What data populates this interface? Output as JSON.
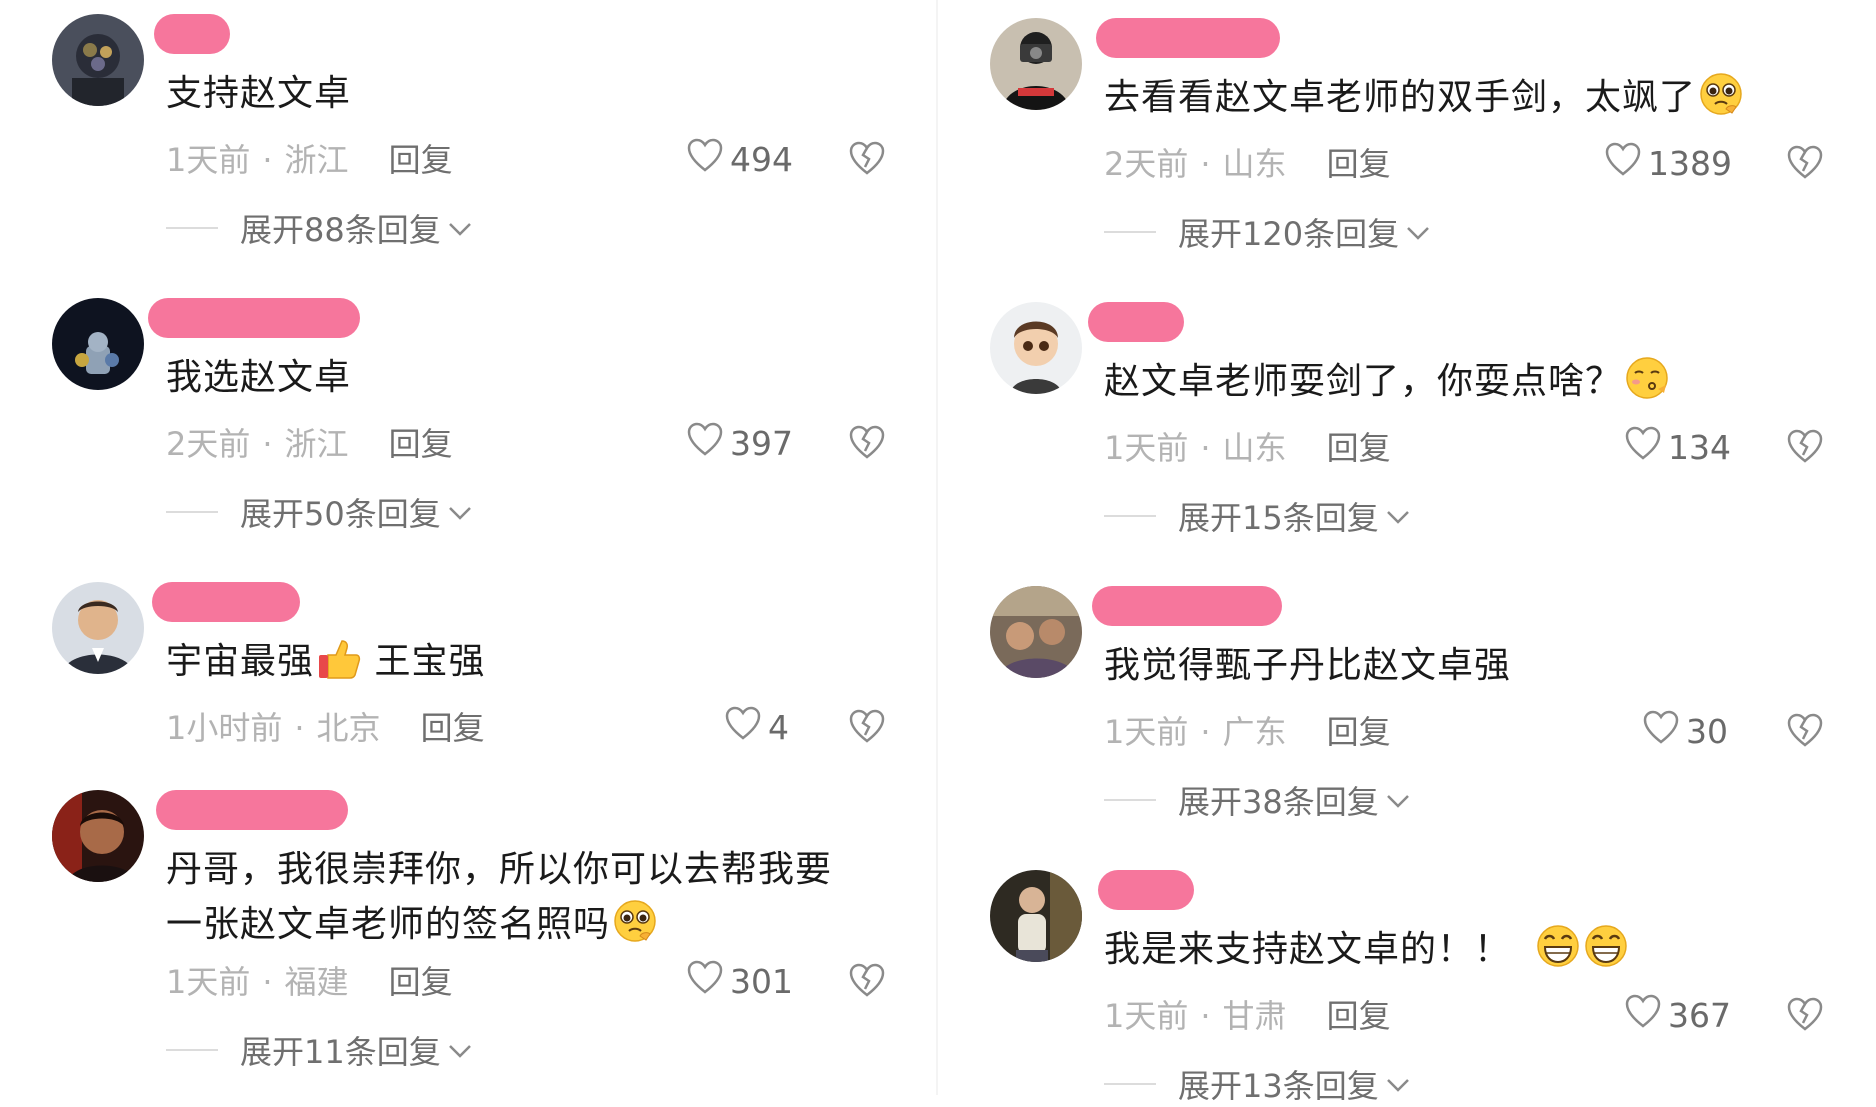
{
  "left": [
    {
      "text": "支持赵文卓",
      "time": "1天前",
      "location": "浙江",
      "reply": "回复",
      "likes": "494",
      "expand": "展开88条回复",
      "emoji": []
    },
    {
      "text": "我选赵文卓",
      "time": "2天前",
      "location": "浙江",
      "reply": "回复",
      "likes": "397",
      "expand": "展开50条回复",
      "emoji": []
    },
    {
      "text_a": "宇宙最强",
      "text_b": " 王宝强",
      "time": "1小时前",
      "location": "北京",
      "reply": "回复",
      "likes": "4",
      "expand": "",
      "emoji": [
        "thumbs-up-emoji"
      ]
    },
    {
      "text_line1": "丹哥，我很崇拜你，所以你可以去帮我要",
      "text_line2": "一张赵文卓老师的签名照吗",
      "time": "1天前",
      "location": "福建",
      "reply": "回复",
      "likes": "301",
      "expand": "展开11条回复",
      "emoji": [
        "pleading-emoji"
      ]
    }
  ],
  "right": [
    {
      "text": "去看看赵文卓老师的双手剑，太飒了",
      "time": "2天前",
      "location": "山东",
      "reply": "回复",
      "likes": "1389",
      "expand": "展开120条回复",
      "emoji": [
        "pleading-emoji"
      ]
    },
    {
      "text": "赵文卓老师耍剑了，你耍点啥？",
      "time": "1天前",
      "location": "山东",
      "reply": "回复",
      "likes": "134",
      "expand": "展开15条回复",
      "emoji": [
        "kissing-emoji"
      ]
    },
    {
      "text": "我觉得甄子丹比赵文卓强",
      "time": "1天前",
      "location": "广东",
      "reply": "回复",
      "likes": "30",
      "expand": "展开38条回复",
      "emoji": []
    },
    {
      "text": "我是来支持赵文卓的！！",
      "time": "1天前",
      "location": "甘肃",
      "reply": "回复",
      "likes": "367",
      "expand": "展开13条回复",
      "emoji": [
        "grinning-emoji",
        "grinning-emoji"
      ]
    }
  ],
  "icons": {
    "like": "heart-outline-icon",
    "dislike": "broken-heart-icon",
    "expand": "chevron-down-icon"
  },
  "colors": {
    "name_redaction": "#f6769c",
    "meta": "#b3b3b3",
    "reply": "#6f6f6f"
  }
}
